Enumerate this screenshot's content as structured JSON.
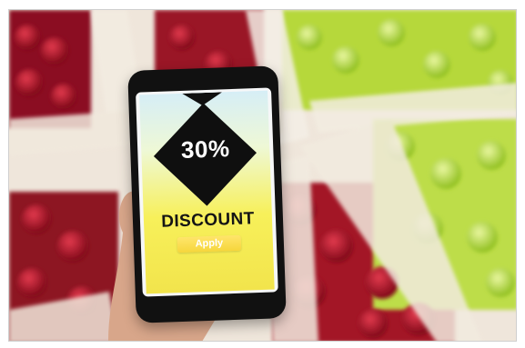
{
  "photo": {
    "description_colors": {
      "red_fruit": "#b5122b",
      "green_fruit": "#b6d83b",
      "crate": "#f0e7d6"
    }
  },
  "phone": {
    "discount_value": "30%",
    "discount_label": "DISCOUNT",
    "apply_label": "Apply",
    "colors": {
      "bg_top": "#d6eef6",
      "bg_bottom": "#f2e44c",
      "diamond": "#0f0f0f",
      "button": "#f6d63c"
    }
  }
}
